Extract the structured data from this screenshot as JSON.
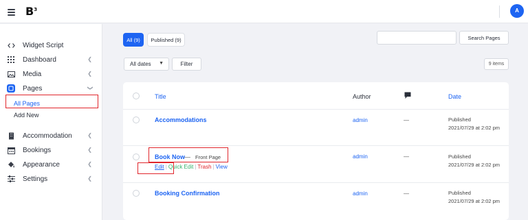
{
  "header": {
    "logo_text": "B",
    "logo_sup": "3",
    "avatar_initial": "A",
    "accent": "#1d64f2"
  },
  "sidebar": {
    "items": [
      {
        "label": "Widget Script",
        "icon": "code-icon"
      },
      {
        "label": "Dashboard",
        "icon": "grid-icon"
      },
      {
        "label": "Media",
        "icon": "image-icon"
      },
      {
        "label": "Pages",
        "icon": "pages-icon"
      },
      {
        "label": "Accommodation",
        "icon": "building-icon"
      },
      {
        "label": "Bookings",
        "icon": "calendar-icon"
      },
      {
        "label": "Appearance",
        "icon": "paint-bucket-icon"
      },
      {
        "label": "Settings",
        "icon": "sliders-icon"
      }
    ],
    "submenu": [
      "All Pages",
      "Add New"
    ],
    "active_submenu": "All Pages"
  },
  "filters": {
    "all_label": "All (9)",
    "published_label": "Published (9)",
    "search_placeholder": "",
    "search_button": "Search Pages",
    "date_select": "All dates",
    "filter_button": "Filter",
    "items_count": "9 items"
  },
  "table": {
    "headers": {
      "title": "Title",
      "author": "Author",
      "date": "Date"
    },
    "rows": [
      {
        "title": "Accommodations",
        "author": "admin",
        "comments": "—",
        "date_status": "Published",
        "date_value": "2021/07/29 at 2:02 pm"
      },
      {
        "title": "Book Now",
        "state_sep": "—",
        "state": "Front Page",
        "author": "admin",
        "comments": "—",
        "date_status": "Published",
        "date_value": "2021/07/29 at 2:02 pm"
      },
      {
        "title": "Booking Confirmation",
        "author": "admin",
        "comments": "—",
        "date_status": "Published",
        "date_value": "2021/07/29 at 2:02 pm"
      }
    ],
    "row_actions": [
      "Edit",
      "Quick Edit",
      "Trash",
      "View"
    ],
    "action_separator": "|"
  },
  "highlight_color": "#e0252b"
}
